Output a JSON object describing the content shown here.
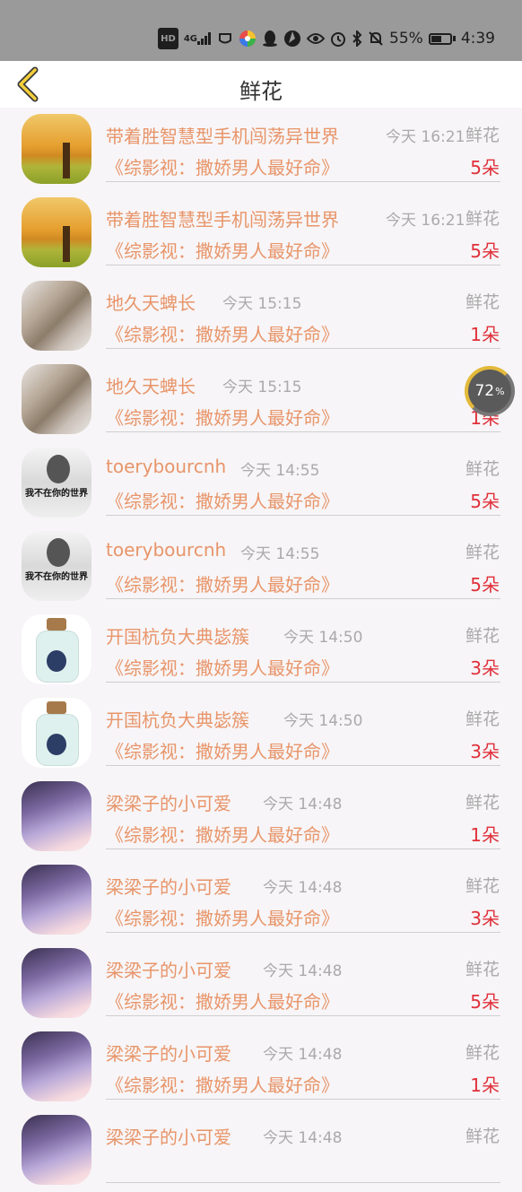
{
  "status_bar": {
    "hd": "HD",
    "network": "4G",
    "battery": "55%",
    "battery_level": 0.55,
    "time": "4:39"
  },
  "header": {
    "title": "鲜花"
  },
  "floating_badge": {
    "value": "72",
    "unit": "%"
  },
  "rows": [
    {
      "avatar": "tree",
      "name": "带着胜智慧型手机闯荡异世界",
      "time": "今天 16:21",
      "type": "鲜花",
      "book": "《综影视：撒娇男人最好命》",
      "count": "5朵"
    },
    {
      "avatar": "tree",
      "name": "带着胜智慧型手机闯荡异世界",
      "time": "今天 16:21",
      "type": "鲜花",
      "book": "《综影视：撒娇男人最好命》",
      "count": "5朵"
    },
    {
      "avatar": "cat",
      "name": "地久天蜱长",
      "time": "今天 15:15",
      "type": "鲜花",
      "book": "《综影视：撒娇男人最好命》",
      "count": "1朵"
    },
    {
      "avatar": "cat",
      "name": "地久天蜱长",
      "time": "今天 15:15",
      "type": "鲜花",
      "book": "《综影视：撒娇男人最好命》",
      "count": "1朵"
    },
    {
      "avatar": "man",
      "name": "toerybourcnh",
      "time": "今天 14:55",
      "type": "鲜花",
      "book": "《综影视：撒娇男人最好命》",
      "count": "5朵",
      "avatar_caption": "我不在你的世界"
    },
    {
      "avatar": "man",
      "name": "toerybourcnh",
      "time": "今天 14:55",
      "type": "鲜花",
      "book": "《综影视：撒娇男人最好命》",
      "count": "5朵",
      "avatar_caption": "我不在你的世界"
    },
    {
      "avatar": "bottle",
      "name": "开国杭负大典毖簇",
      "time": "今天 14:50",
      "type": "鲜花",
      "book": "《综影视：撒娇男人最好命》",
      "count": "3朵"
    },
    {
      "avatar": "bottle",
      "name": "开国杭负大典毖簇",
      "time": "今天 14:50",
      "type": "鲜花",
      "book": "《综影视：撒娇男人最好命》",
      "count": "3朵"
    },
    {
      "avatar": "purple",
      "name": "梁梁子的小可爱",
      "time": "今天 14:48",
      "type": "鲜花",
      "book": "《综影视：撒娇男人最好命》",
      "count": "1朵"
    },
    {
      "avatar": "purple",
      "name": "梁梁子的小可爱",
      "time": "今天 14:48",
      "type": "鲜花",
      "book": "《综影视：撒娇男人最好命》",
      "count": "3朵"
    },
    {
      "avatar": "purple",
      "name": "梁梁子的小可爱",
      "time": "今天 14:48",
      "type": "鲜花",
      "book": "《综影视：撒娇男人最好命》",
      "count": "5朵"
    },
    {
      "avatar": "purple",
      "name": "梁梁子的小可爱",
      "time": "今天 14:48",
      "type": "鲜花",
      "book": "《综影视：撒娇男人最好命》",
      "count": "1朵"
    },
    {
      "avatar": "purple",
      "name": "梁梁子的小可爱",
      "time": "今天 14:48",
      "type": "鲜花",
      "book": "",
      "count": ""
    }
  ]
}
